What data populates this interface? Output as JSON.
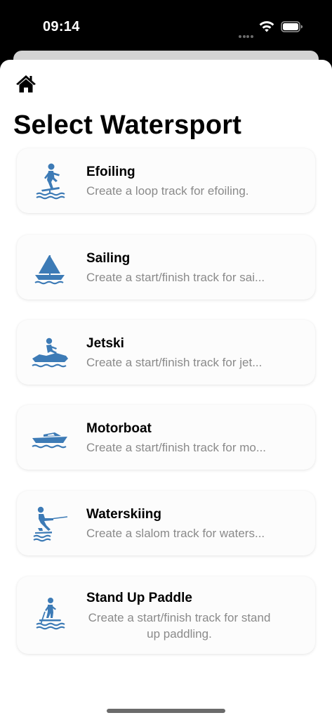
{
  "status_bar": {
    "time": "09:14"
  },
  "header": {
    "title": "Select Watersport",
    "home_icon": "house-icon"
  },
  "sports": [
    {
      "title": "Efoiling",
      "description": "Create a loop track for efoiling.",
      "icon": "efoil-icon"
    },
    {
      "title": "Sailing",
      "description": "Create a start/finish track for sai...",
      "icon": "sailboat-icon"
    },
    {
      "title": "Jetski",
      "description": "Create a start/finish track for jet...",
      "icon": "jetski-icon"
    },
    {
      "title": "Motorboat",
      "description": "Create a start/finish track for mo...",
      "icon": "motorboat-icon"
    },
    {
      "title": "Waterskiing",
      "description": "Create a slalom track for waters...",
      "icon": "waterski-icon"
    },
    {
      "title": "Stand Up Paddle",
      "description": "Create a start/finish track for stand up paddling.",
      "icon": "paddleboard-icon"
    }
  ],
  "colors": {
    "icon_blue": "#3d7bb6",
    "card_bg": "#fcfcfc",
    "desc_gray": "#8a8a8a"
  }
}
